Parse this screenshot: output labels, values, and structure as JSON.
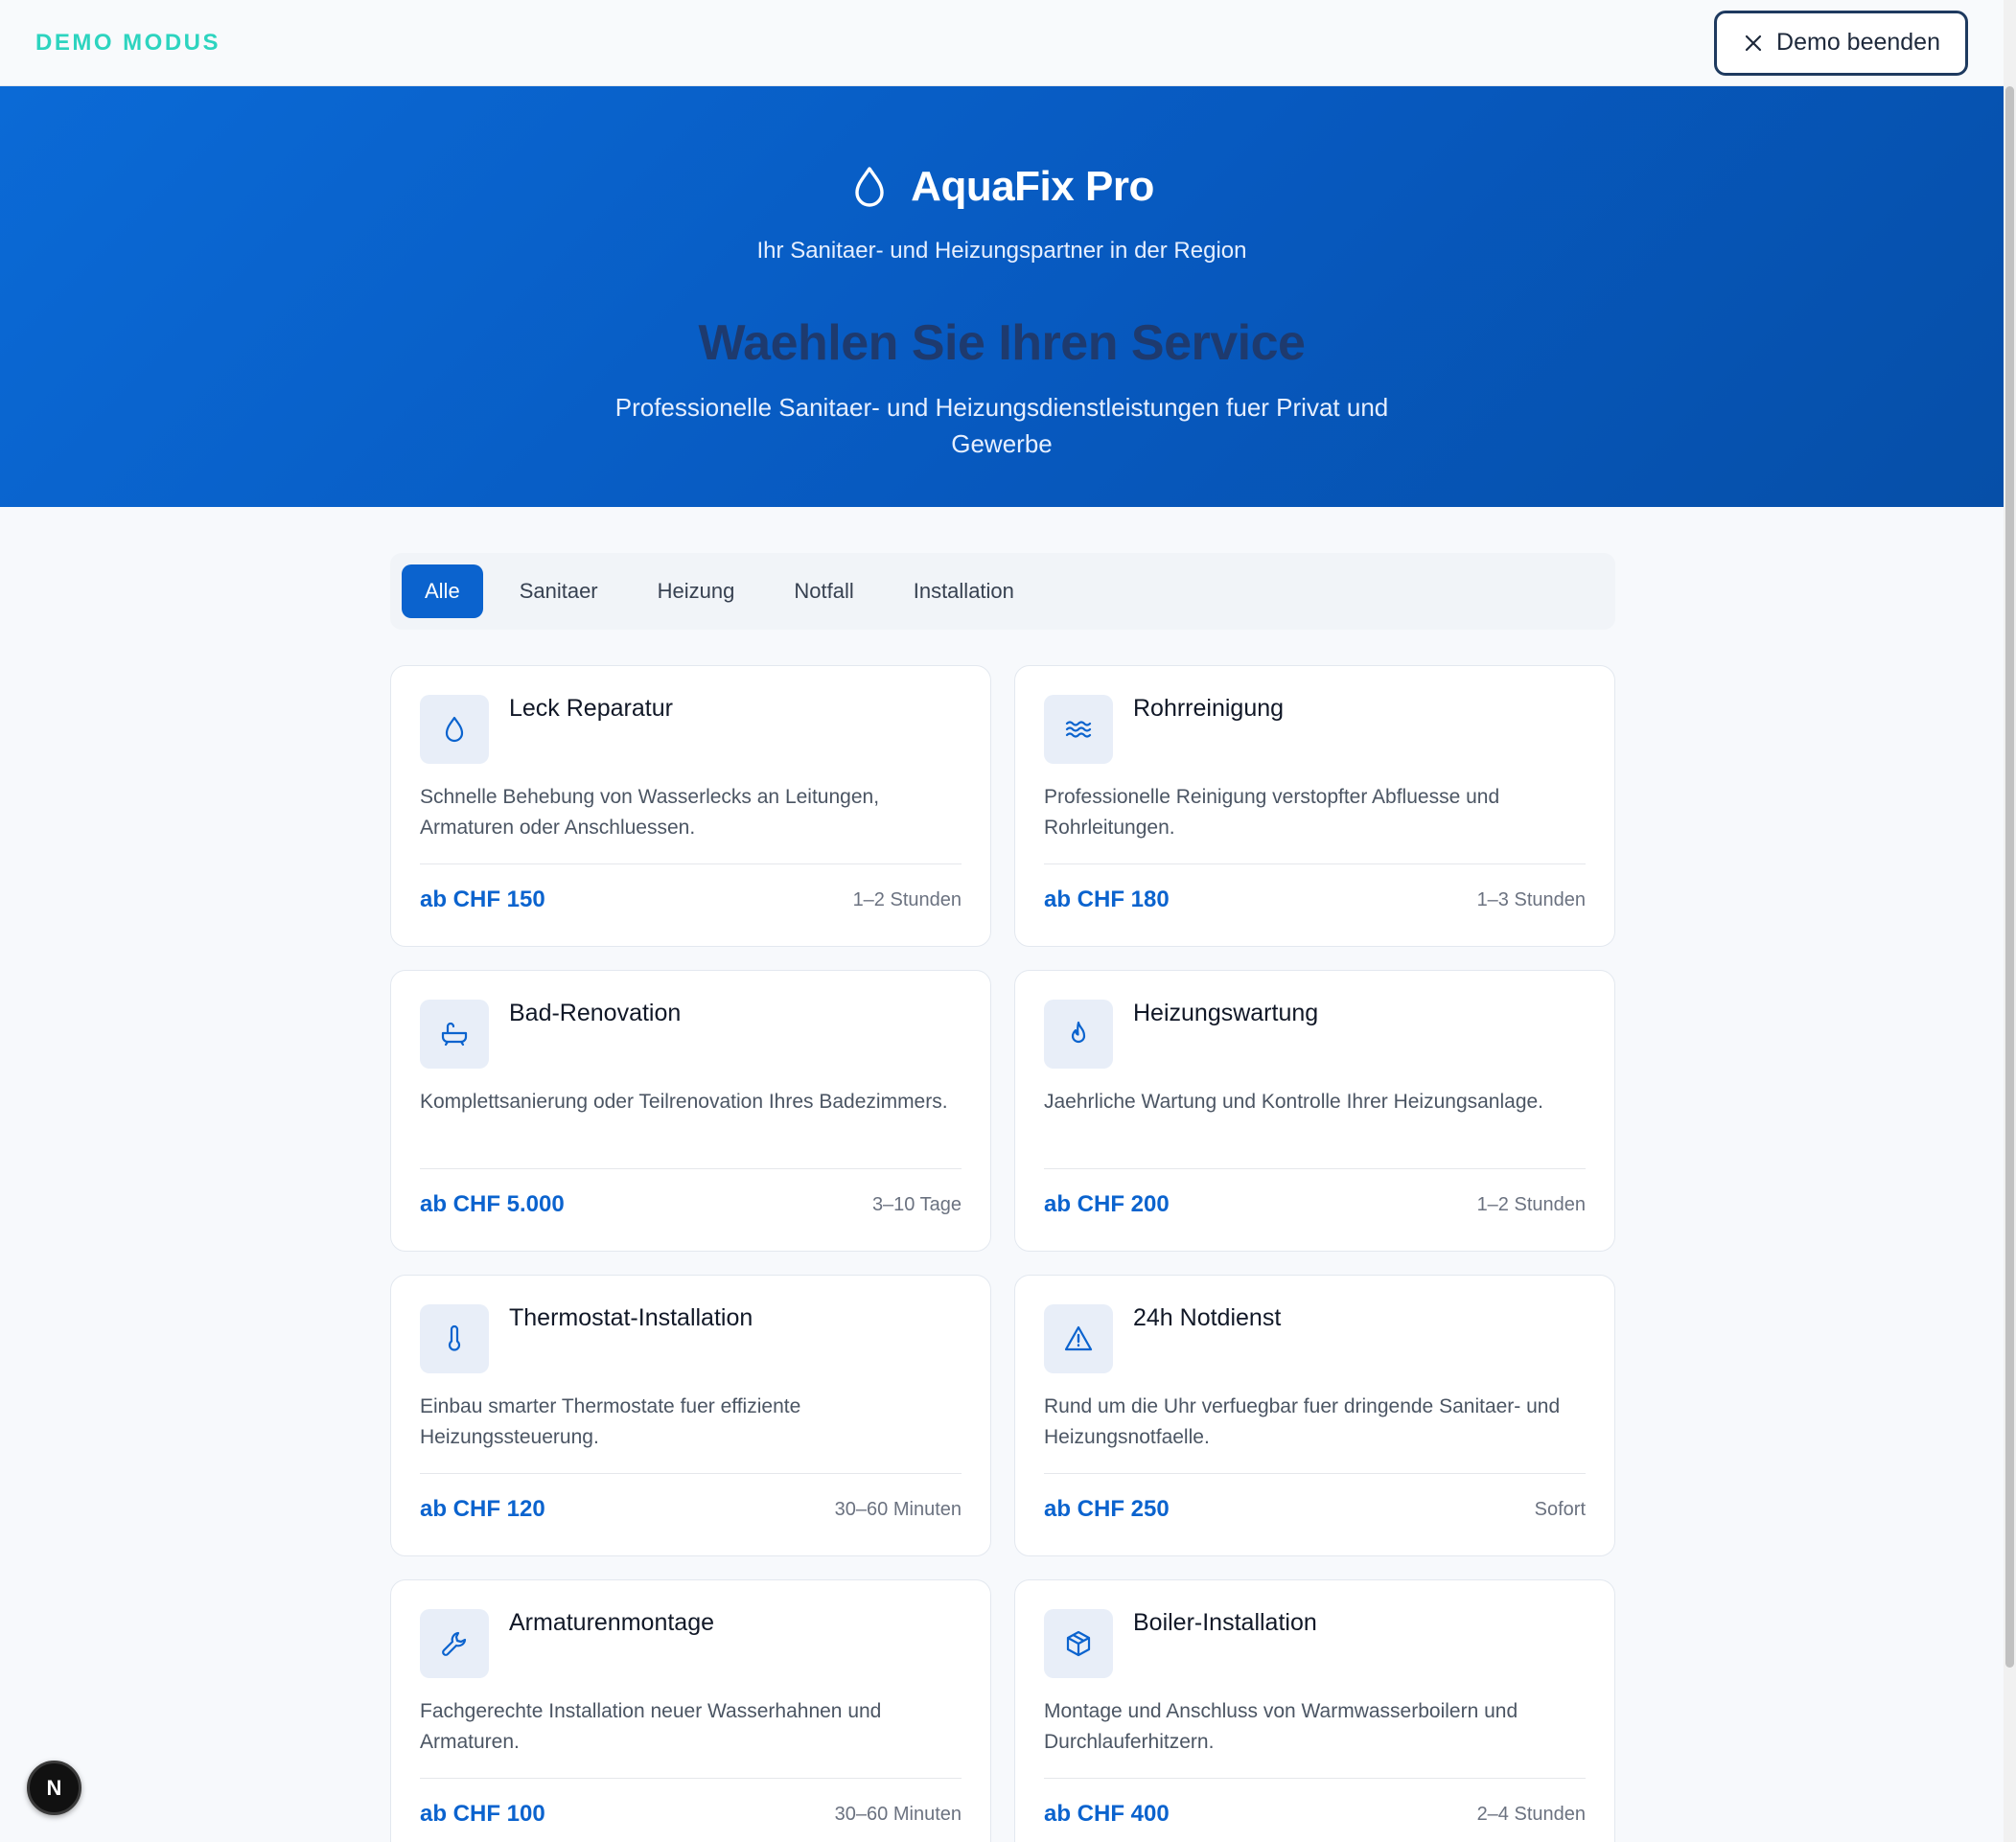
{
  "demo": {
    "label": "DEMO MODUS",
    "exit_label": "Demo beenden"
  },
  "hero": {
    "brand_name": "AquaFix Pro",
    "tagline": "Ihr Sanitaer- und Heizungspartner in der Region",
    "headline": "Waehlen Sie Ihren Service",
    "subline": "Professionelle Sanitaer- und Heizungsdienstleistungen fuer Privat und Gewerbe"
  },
  "tabs": [
    {
      "label": "Alle",
      "active": true
    },
    {
      "label": "Sanitaer",
      "active": false
    },
    {
      "label": "Heizung",
      "active": false
    },
    {
      "label": "Notfall",
      "active": false
    },
    {
      "label": "Installation",
      "active": false
    }
  ],
  "services": [
    {
      "icon": "drop-icon",
      "title": "Leck Reparatur",
      "description": "Schnelle Behebung von Wasserlecks an Leitungen, Armaturen oder Anschluessen.",
      "price": "ab CHF 150",
      "duration": "1–2 Stunden"
    },
    {
      "icon": "waves-icon",
      "title": "Rohrreinigung",
      "description": "Professionelle Reinigung verstopfter Abfluesse und Rohrleitungen.",
      "price": "ab CHF 180",
      "duration": "1–3 Stunden"
    },
    {
      "icon": "bathtub-icon",
      "title": "Bad-Renovation",
      "description": "Komplettsanierung oder Teilrenovation Ihres Badezimmers.",
      "price": "ab CHF 5.000",
      "duration": "3–10 Tage"
    },
    {
      "icon": "flame-icon",
      "title": "Heizungswartung",
      "description": "Jaehrliche Wartung und Kontrolle Ihrer Heizungsanlage.",
      "price": "ab CHF 200",
      "duration": "1–2 Stunden"
    },
    {
      "icon": "thermometer-icon",
      "title": "Thermostat-Installation",
      "description": "Einbau smarter Thermostate fuer effiziente Heizungssteuerung.",
      "price": "ab CHF 120",
      "duration": "30–60 Minuten"
    },
    {
      "icon": "warning-icon",
      "title": "24h Notdienst",
      "description": "Rund um die Uhr verfuegbar fuer dringende Sanitaer- und Heizungsnotfaelle.",
      "price": "ab CHF 250",
      "duration": "Sofort"
    },
    {
      "icon": "wrench-icon",
      "title": "Armaturenmontage",
      "description": "Fachgerechte Installation neuer Wasserhahnen und Armaturen.",
      "price": "ab CHF 100",
      "duration": "30–60 Minuten"
    },
    {
      "icon": "box-icon",
      "title": "Boiler-Installation",
      "description": "Montage und Anschluss von Warmwasserboilern und Durchlauferhitzern.",
      "price": "ab CHF 400",
      "duration": "2–4 Stunden"
    }
  ],
  "badge": {
    "label": "N"
  },
  "colors": {
    "accent": "#0b63ce",
    "demo_label": "#2dd4bf",
    "hero_gradient_start": "#0b6ad6",
    "hero_gradient_end": "#064fa8"
  }
}
